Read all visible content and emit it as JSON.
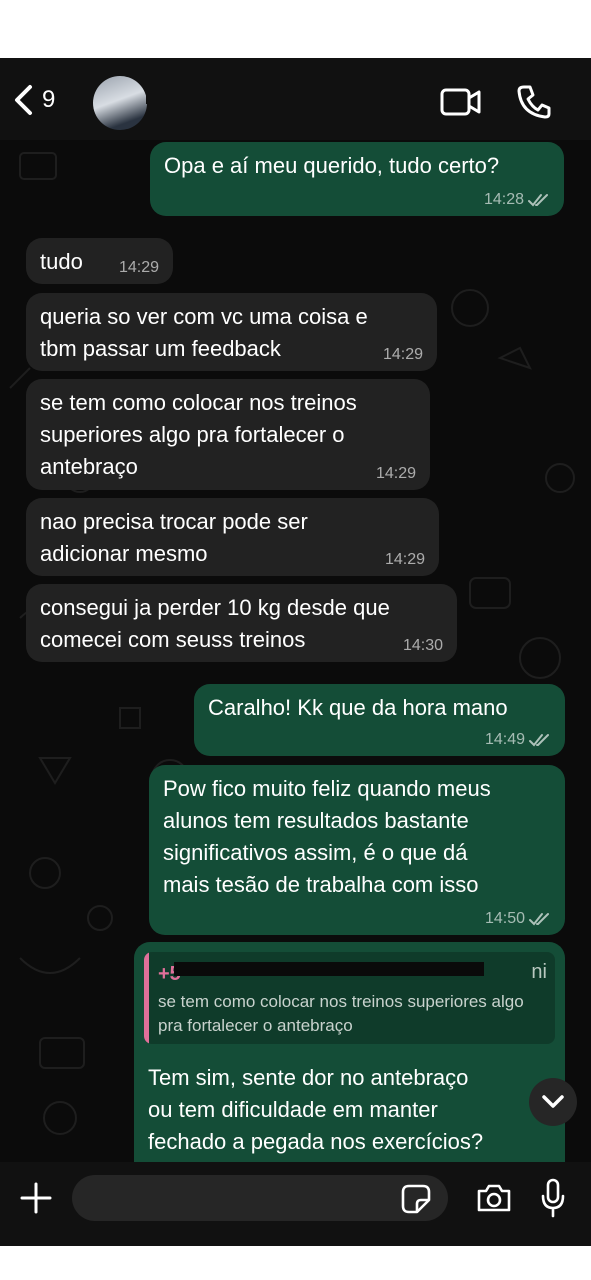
{
  "header": {
    "back_count": "9",
    "contact_name": ""
  },
  "messages": [
    {
      "text": "Opa e aí meu querido, tudo certo?",
      "time": "14:28",
      "direction": "out",
      "status": "read"
    },
    {
      "text": "tudo",
      "time": "14:29",
      "direction": "in"
    },
    {
      "text": "queria so ver com vc uma coisa e\ntbm passar um feedback",
      "time": "14:29",
      "direction": "in"
    },
    {
      "text": "se tem como colocar nos treinos\nsuperiores algo pra fortalecer o\nantebraço",
      "time": "14:29",
      "direction": "in"
    },
    {
      "text": "nao precisa trocar pode ser\nadicionar mesmo",
      "time": "14:29",
      "direction": "in"
    },
    {
      "text": "consegui ja perder 10 kg desde que\ncomecei com seuss treinos",
      "time": "14:30",
      "direction": "in"
    },
    {
      "text": "Caralho! Kk que da hora mano",
      "time": "14:49",
      "direction": "out",
      "status": "read"
    },
    {
      "text": "Pow fico muito feliz quando meus\nalunos tem resultados bastante\nsignificativos assim, é o que dá\nmais tesão de trabalha com isso",
      "time": "14:50",
      "direction": "out",
      "status": "read"
    }
  ],
  "reply": {
    "quote_sender_prefix": "+5",
    "quote_contact": "ni",
    "quote_text": "se tem como colocar nos treinos superiores algo pra fortalecer o antebraço",
    "text": "Tem sim, sente dor no antebraço\nou tem dificuldade em manter\nfechado a pegada nos exercícios?"
  },
  "composer": {
    "placeholder": ""
  },
  "colors": {
    "outgoing_bubble": "#144d37",
    "incoming_bubble": "#222222",
    "quote_accent": "#e0709a",
    "background": "#0b0b0b"
  },
  "icons": [
    "back-chevron-icon",
    "video-call-icon",
    "phone-icon",
    "plus-icon",
    "sticker-icon",
    "camera-icon",
    "microphone-icon",
    "chevron-down-icon",
    "double-check-icon"
  ]
}
